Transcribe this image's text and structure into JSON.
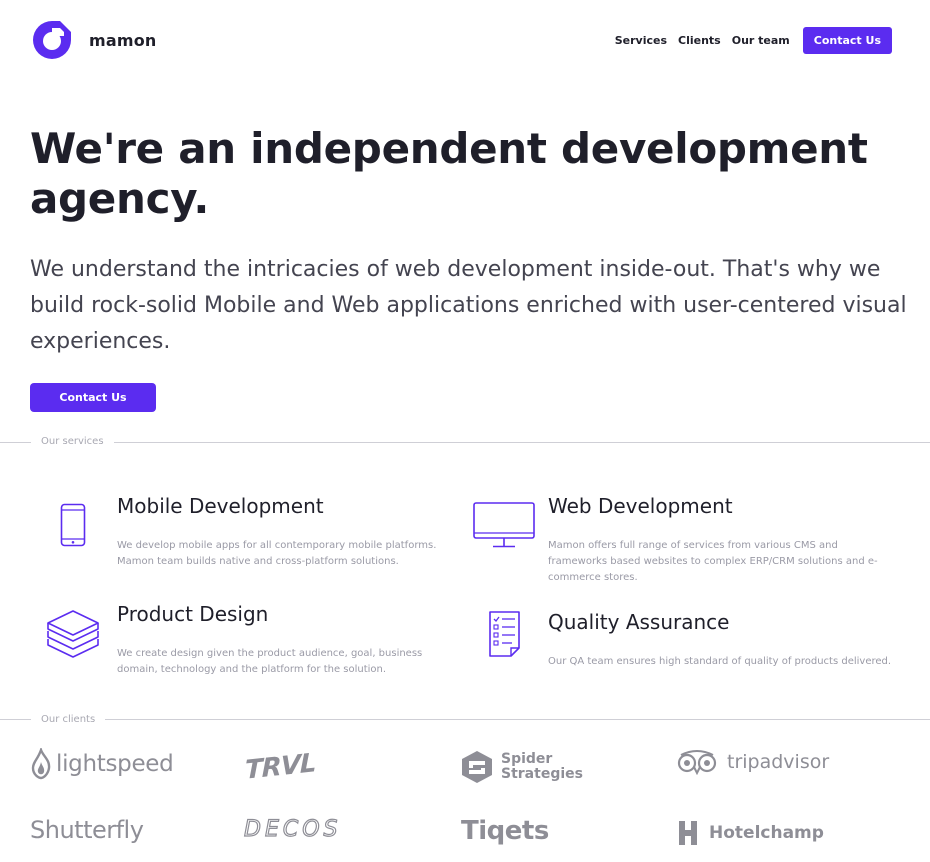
{
  "brand": {
    "name": "mamon",
    "accent": "#5b2cf0"
  },
  "nav": {
    "items": [
      "Services",
      "Clients",
      "Our team"
    ],
    "cta": "Contact Us"
  },
  "hero": {
    "title": "We're an independent development agency.",
    "subtitle": "We understand the intricacies of web development inside-out. That's why we build rock-solid Mobile and Web applications enriched with user-centered visual experiences.",
    "cta": "Contact Us"
  },
  "services": {
    "section_label": "Our services",
    "items": [
      {
        "icon": "smartphone-icon",
        "title": "Mobile Development",
        "desc": "We develop mobile apps for all contemporary mobile platforms. Mamon team builds native and cross-platform solutions."
      },
      {
        "icon": "monitor-icon",
        "title": "Web Development",
        "desc": "Mamon offers full range of services from various CMS and frameworks based websites to complex ERP/CRM solutions and e-commerce stores."
      },
      {
        "icon": "layers-icon",
        "title": "Product Design",
        "desc": "We create design given the product audience, goal, business domain, technology and the platform for the solution."
      },
      {
        "icon": "checklist-icon",
        "title": "Quality Assurance",
        "desc": "Our QA team ensures high standard of quality of products delivered."
      }
    ]
  },
  "clients": {
    "section_label": "Our clients",
    "logos": [
      {
        "name": "lightspeed",
        "text": "lightspeed"
      },
      {
        "name": "travel",
        "text": "TRVL"
      },
      {
        "name": "spider-strategies",
        "line1": "Spider",
        "line2": "Strategies"
      },
      {
        "name": "tripadvisor",
        "text": "tripadvisor"
      },
      {
        "name": "shutterfly",
        "text": "Shutterfly"
      },
      {
        "name": "decos",
        "text": "DECOS"
      },
      {
        "name": "tiqets",
        "text": "Tiqets"
      },
      {
        "name": "hotelchamp",
        "text": "Hotelchamp"
      }
    ]
  }
}
